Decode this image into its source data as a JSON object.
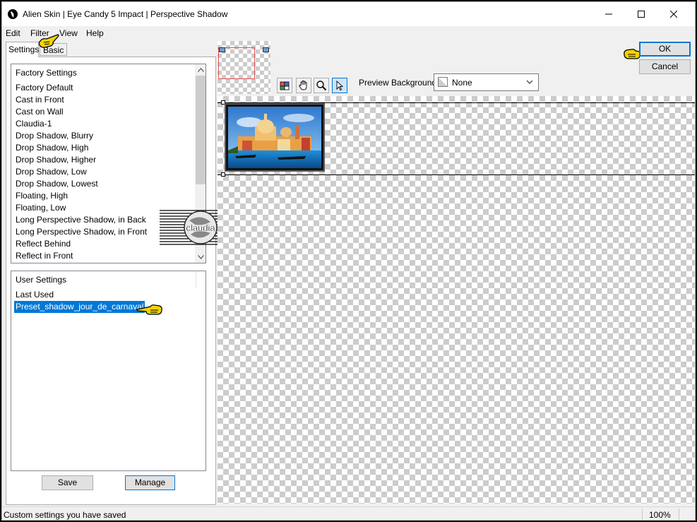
{
  "window": {
    "title": "Alien Skin | Eye Candy 5 Impact | Perspective Shadow"
  },
  "menu": [
    "Edit",
    "Filter",
    "View",
    "Help"
  ],
  "tabs": {
    "settings": "Settings",
    "basic": "Basic"
  },
  "factory_settings": {
    "header": "Factory Settings",
    "items": [
      "Factory Default",
      "Cast in Front",
      "Cast on Wall",
      "Claudia-1",
      "Drop Shadow, Blurry",
      "Drop Shadow, High",
      "Drop Shadow, Higher",
      "Drop Shadow, Low",
      "Drop Shadow, Lowest",
      "Floating, High",
      "Floating, Low",
      "Long Perspective Shadow, in Back",
      "Long Perspective Shadow, in Front",
      "Reflect Behind",
      "Reflect in Front"
    ]
  },
  "user_settings": {
    "header": "User Settings",
    "items": [
      "Last Used",
      "Preset_shadow_jour_de_carnaval"
    ],
    "selected": "Preset_shadow_jour_de_carnaval"
  },
  "buttons": {
    "save": "Save",
    "manage": "Manage",
    "ok": "OK",
    "cancel": "Cancel"
  },
  "preview": {
    "background_label": "Preview Background:",
    "background_value": "None"
  },
  "watermark": {
    "text": "claudia"
  },
  "status": {
    "text": "Custom settings you have saved",
    "zoom": "100%"
  },
  "colors": {
    "selection": "#0078d7",
    "accent": "#0078d7"
  }
}
